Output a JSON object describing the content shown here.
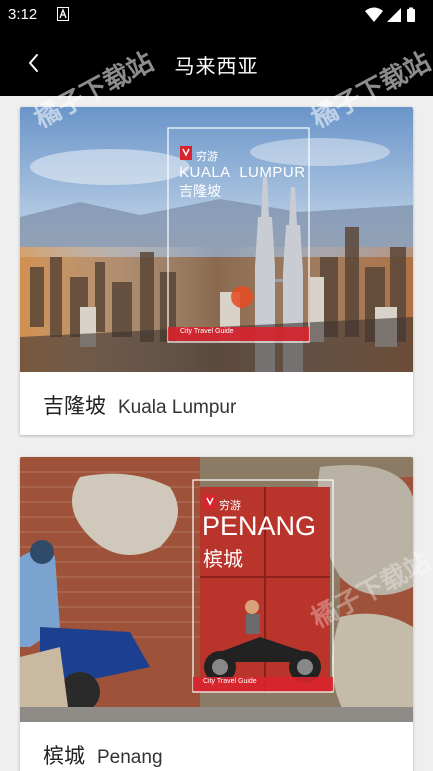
{
  "status_bar": {
    "time": "3:12",
    "icons": [
      "notification-icon",
      "wifi-icon",
      "signal-icon",
      "battery-icon"
    ]
  },
  "app_bar": {
    "title": "马来西亚",
    "back_icon": "chevron-left-icon"
  },
  "watermark": "橘子下载站",
  "cities": [
    {
      "name_cn": "吉隆坡",
      "name_en": "Kuala Lumpur",
      "cover": {
        "brand": "穷游",
        "title_en": "KUALA  LUMPUR",
        "title_cn": "吉隆坡",
        "series": "City Travel Guide"
      }
    },
    {
      "name_cn": "槟城",
      "name_en": "Penang",
      "cover": {
        "brand": "穷游",
        "title_en": "PENANG",
        "title_cn": "槟城",
        "series": "City Travel Guide"
      }
    }
  ],
  "colors": {
    "bar_background": "#000000",
    "page_background": "#efefef",
    "brand_red": "#d9232e"
  }
}
